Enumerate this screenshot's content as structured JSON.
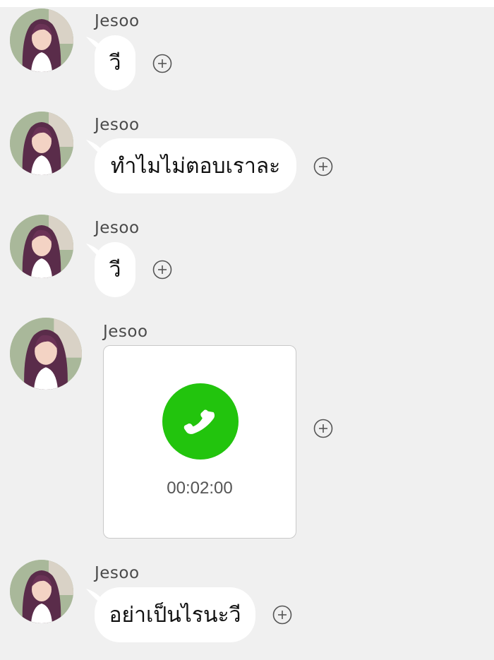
{
  "messages": [
    {
      "sender": "Jesoo",
      "text": "วี"
    },
    {
      "sender": "Jesoo",
      "text": "ทำไมไม่ตอบเราละ"
    },
    {
      "sender": "Jesoo",
      "text": "วี"
    },
    {
      "sender": "Jesoo",
      "call": {
        "duration": "00:02:00"
      }
    },
    {
      "sender": "Jesoo",
      "text": "อย่าเป็นไรนะวี"
    }
  ],
  "icons": {
    "avatar": "profile-photo",
    "add": "plus-circle-icon",
    "call": "phone-icon"
  },
  "colors": {
    "background": "#f0f0f0",
    "bubble": "#ffffff",
    "call_green": "#22c40d"
  }
}
